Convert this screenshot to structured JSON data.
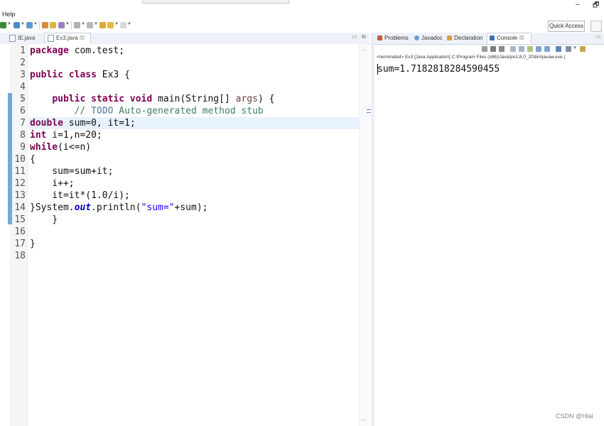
{
  "window": {
    "minimize_glyph": "–",
    "restore_glyph": "🗗"
  },
  "menu": {
    "items": [
      "Help"
    ]
  },
  "toolbar": {
    "quick_access_placeholder": "Quick Access"
  },
  "editor": {
    "tabs": [
      {
        "label": "IE.java",
        "active": false
      },
      {
        "label": "Ex3.java",
        "active": true,
        "close": "☒"
      }
    ],
    "current_line": 7,
    "line_numbers": [
      "1",
      "2",
      "3",
      "4",
      "5",
      "6",
      "7",
      "8",
      "9",
      "10",
      "11",
      "12",
      "13",
      "14",
      "15",
      "16",
      "17",
      "18"
    ],
    "code": {
      "l1_kw": "package",
      "l1_rest": " com.test;",
      "l3_kw1": "public",
      "l3_kw2": "class",
      "l3_rest": " Ex3 {",
      "l5_kw1": "public",
      "l5_kw2": "static",
      "l5_kw3": "void",
      "l5_rest": " main(String[] ",
      "l5_arg": "args",
      "l5_end": ") {",
      "l6_cmt1": "// ",
      "l6_todo": "TODO",
      "l6_cmt2": " Auto-generated method stub",
      "l7_kw": "double",
      "l7_rest": " sum=0, it=1;",
      "l8_kw": "int",
      "l8_rest": " i=1,n=20;",
      "l9_kw": "while",
      "l9_rest": "(i<=n)",
      "l10": "{",
      "l11": "    sum=sum+it;",
      "l12": "    i++;",
      "l13": "    it=it*(1.0/i);",
      "l14_a": "}System.",
      "l14_fld": "out",
      "l14_b": ".println(",
      "l14_str": "\"sum=\"",
      "l14_c": "+sum);",
      "l15": "    }",
      "l17": "}"
    }
  },
  "console": {
    "tabs": [
      {
        "label": "Problems",
        "icon": "problems-icon"
      },
      {
        "label": "Javadoc",
        "icon": "javadoc-icon"
      },
      {
        "label": "Declaration",
        "icon": "declaration-icon"
      },
      {
        "label": "Console",
        "icon": "console-icon",
        "active": true,
        "close": "☒"
      }
    ],
    "status": "<terminated> Ex3 [Java Application] C:\\Program Files (x86)\\Java\\jre1.8.0_20\\bin\\javaw.exe (",
    "output": "sum=1.7182818284590455"
  },
  "watermark": "CSDN @Hlai",
  "colors": {
    "keyword": "#7f0055",
    "string": "#2a00ff",
    "comment": "#3f7f5f",
    "field": "#0000c0",
    "current_line": "#e8f2fe"
  }
}
